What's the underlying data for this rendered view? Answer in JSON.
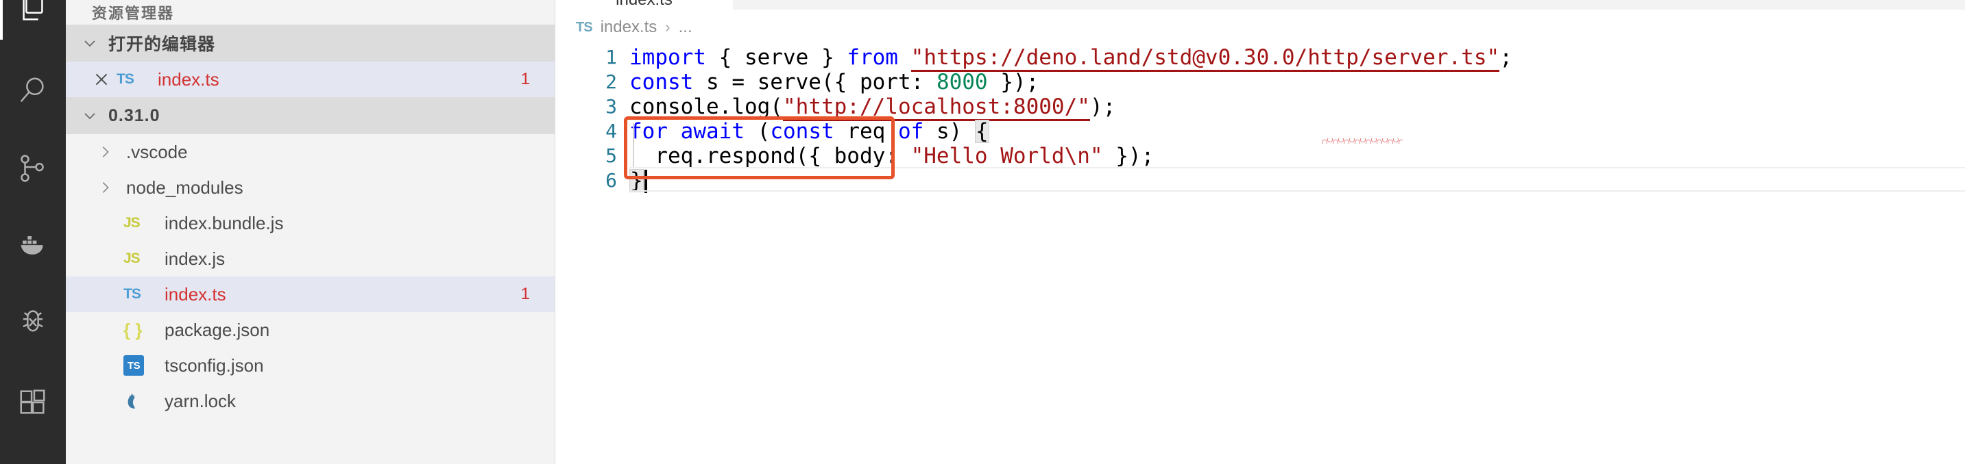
{
  "activity_bar": {
    "items": [
      {
        "name": "explorer",
        "icon": "files-icon",
        "active": true
      },
      {
        "name": "search",
        "icon": "search-icon",
        "active": false
      },
      {
        "name": "source-control",
        "icon": "source-control-icon",
        "active": false
      },
      {
        "name": "docker",
        "icon": "docker-icon",
        "active": false
      },
      {
        "name": "run-and-debug",
        "icon": "debug-icon",
        "active": false
      },
      {
        "name": "extensions",
        "icon": "extensions-icon",
        "active": false
      }
    ]
  },
  "sidebar": {
    "view_title": "资源管理器",
    "open_editors": {
      "label": "打开的编辑器",
      "expanded": true,
      "chevron": "chevron-down-icon",
      "items": [
        {
          "close_icon": "close-icon",
          "file_icon": "TS",
          "name": "index.ts",
          "badge": "1",
          "selected": true,
          "error": true
        }
      ]
    },
    "folder": {
      "label": "0.31.0",
      "expanded": true,
      "chevron": "chevron-down-icon",
      "items": [
        {
          "type": "folder",
          "twisty": "chevron-right-icon",
          "name": ".vscode",
          "icon": "folder-icon",
          "badge": "",
          "selected": false,
          "error": false
        },
        {
          "type": "folder",
          "twisty": "chevron-right-icon",
          "name": "node_modules",
          "icon": "folder-icon",
          "badge": "",
          "selected": false,
          "error": false
        },
        {
          "type": "file",
          "twisty": "",
          "name": "index.bundle.js",
          "icon": "JS",
          "badge": "",
          "selected": false,
          "error": false
        },
        {
          "type": "file",
          "twisty": "",
          "name": "index.js",
          "icon": "JS",
          "badge": "",
          "selected": false,
          "error": false
        },
        {
          "type": "file",
          "twisty": "",
          "name": "index.ts",
          "icon": "TS",
          "badge": "1",
          "selected": true,
          "error": true
        },
        {
          "type": "file",
          "twisty": "",
          "name": "package.json",
          "icon": "JSON",
          "badge": "",
          "selected": false,
          "error": false
        },
        {
          "type": "file",
          "twisty": "",
          "name": "tsconfig.json",
          "icon": "TSCONFIG",
          "badge": "",
          "selected": false,
          "error": false
        },
        {
          "type": "file",
          "twisty": "",
          "name": "yarn.lock",
          "icon": "YARN",
          "badge": "",
          "selected": false,
          "error": false
        }
      ]
    }
  },
  "editor": {
    "tab": {
      "label": "index.ts",
      "icon": "TS",
      "active": true
    },
    "breadcrumb": {
      "icon": "TS",
      "file": "index.ts",
      "separator": "›",
      "more": "..."
    },
    "lines": [
      {
        "n": "1",
        "text": "import { serve } from \"https://deno.land/std@v0.30.0/http/server.ts\";"
      },
      {
        "n": "2",
        "text": "const s = serve({ port: 8000 });"
      },
      {
        "n": "3",
        "text": "console.log(\"http://localhost:8000/\");"
      },
      {
        "n": "4",
        "text": "for await (const req of s) {"
      },
      {
        "n": "5",
        "text": "  req.respond({ body: \"Hello World\\n\" });"
      },
      {
        "n": "6",
        "text": "}"
      }
    ],
    "tokens": {
      "l1": {
        "import": "import",
        "braceL": " { ",
        "serve": "serve",
        "braceR": " } ",
        "from": "from",
        "space": " ",
        "quote": "\"",
        "url": "https://deno.land/std@v0.30.0/http/server.ts",
        "endquote": "\"",
        "semi": ";"
      },
      "l2": {
        "const": "const",
        "mid": " s = serve({ port: ",
        "num": "8000",
        "end": " });"
      },
      "l3": {
        "pre": "console.log(",
        "str": "\"http://localhost:8000/\"",
        "end": ");"
      },
      "l4": {
        "for": "for",
        "sp1": " ",
        "await": "await",
        "sp2": " (",
        "const": "const",
        "mid": " req ",
        "of": "of",
        "end": " s) ",
        "brace": "{"
      },
      "l5": {
        "pre": "  req.respond({ body: ",
        "str": "\"Hello World\\n\"",
        "end": " });"
      },
      "l6": {
        "brace": "}"
      }
    },
    "error_marker": {
      "word": "await",
      "kind": "red-squiggle"
    },
    "annotation_box": {
      "kind": "highlight-rectangle",
      "color": "#e8522a"
    },
    "cursor": {
      "line": 6,
      "column": 2
    }
  },
  "colors": {
    "keyword": "#0000ff",
    "string": "#a31515",
    "number": "#098658",
    "line_number": "#237893",
    "error": "#d33131",
    "annotation": "#e8522a",
    "selection": "#e4e6f1",
    "sidebar_bg": "#f3f3f3",
    "activity_bg": "#2c2c2c"
  }
}
